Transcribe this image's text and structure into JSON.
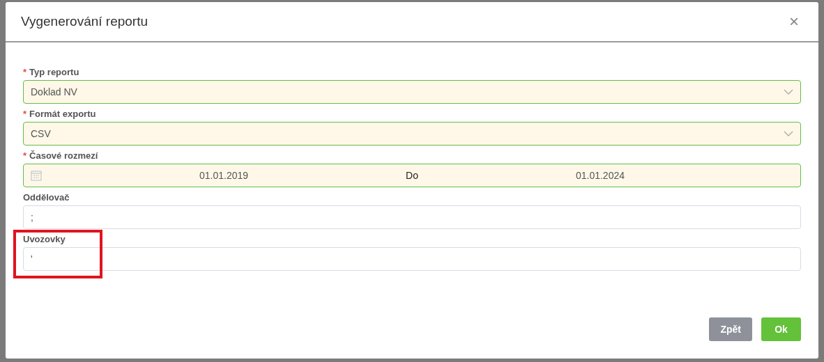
{
  "dialog": {
    "title": "Vygenerování reportu",
    "close": "×"
  },
  "fields": [
    {
      "kind": "select",
      "required_mark": "*",
      "label": "Typ reportu",
      "valid": true,
      "value": "Doklad NV",
      "highlighted": false
    },
    {
      "kind": "select",
      "required_mark": "*",
      "label": "Formát exportu",
      "valid": true,
      "value": "CSV",
      "highlighted": false
    },
    {
      "kind": "daterange",
      "required_mark": "*",
      "label": "Časové rozmezí",
      "valid": true,
      "from": "01.01.2019",
      "separator": "Do",
      "to": "01.01.2024",
      "highlighted": false
    },
    {
      "kind": "text",
      "label": "Oddělovač",
      "valid": false,
      "value": ";",
      "highlighted": false
    },
    {
      "kind": "text",
      "label": "Uvozovky",
      "valid": false,
      "value": "'",
      "highlighted": true
    }
  ],
  "buttons": [
    {
      "label": "Zpět",
      "kind": "back"
    },
    {
      "label": "Ok",
      "kind": "confirm"
    }
  ]
}
